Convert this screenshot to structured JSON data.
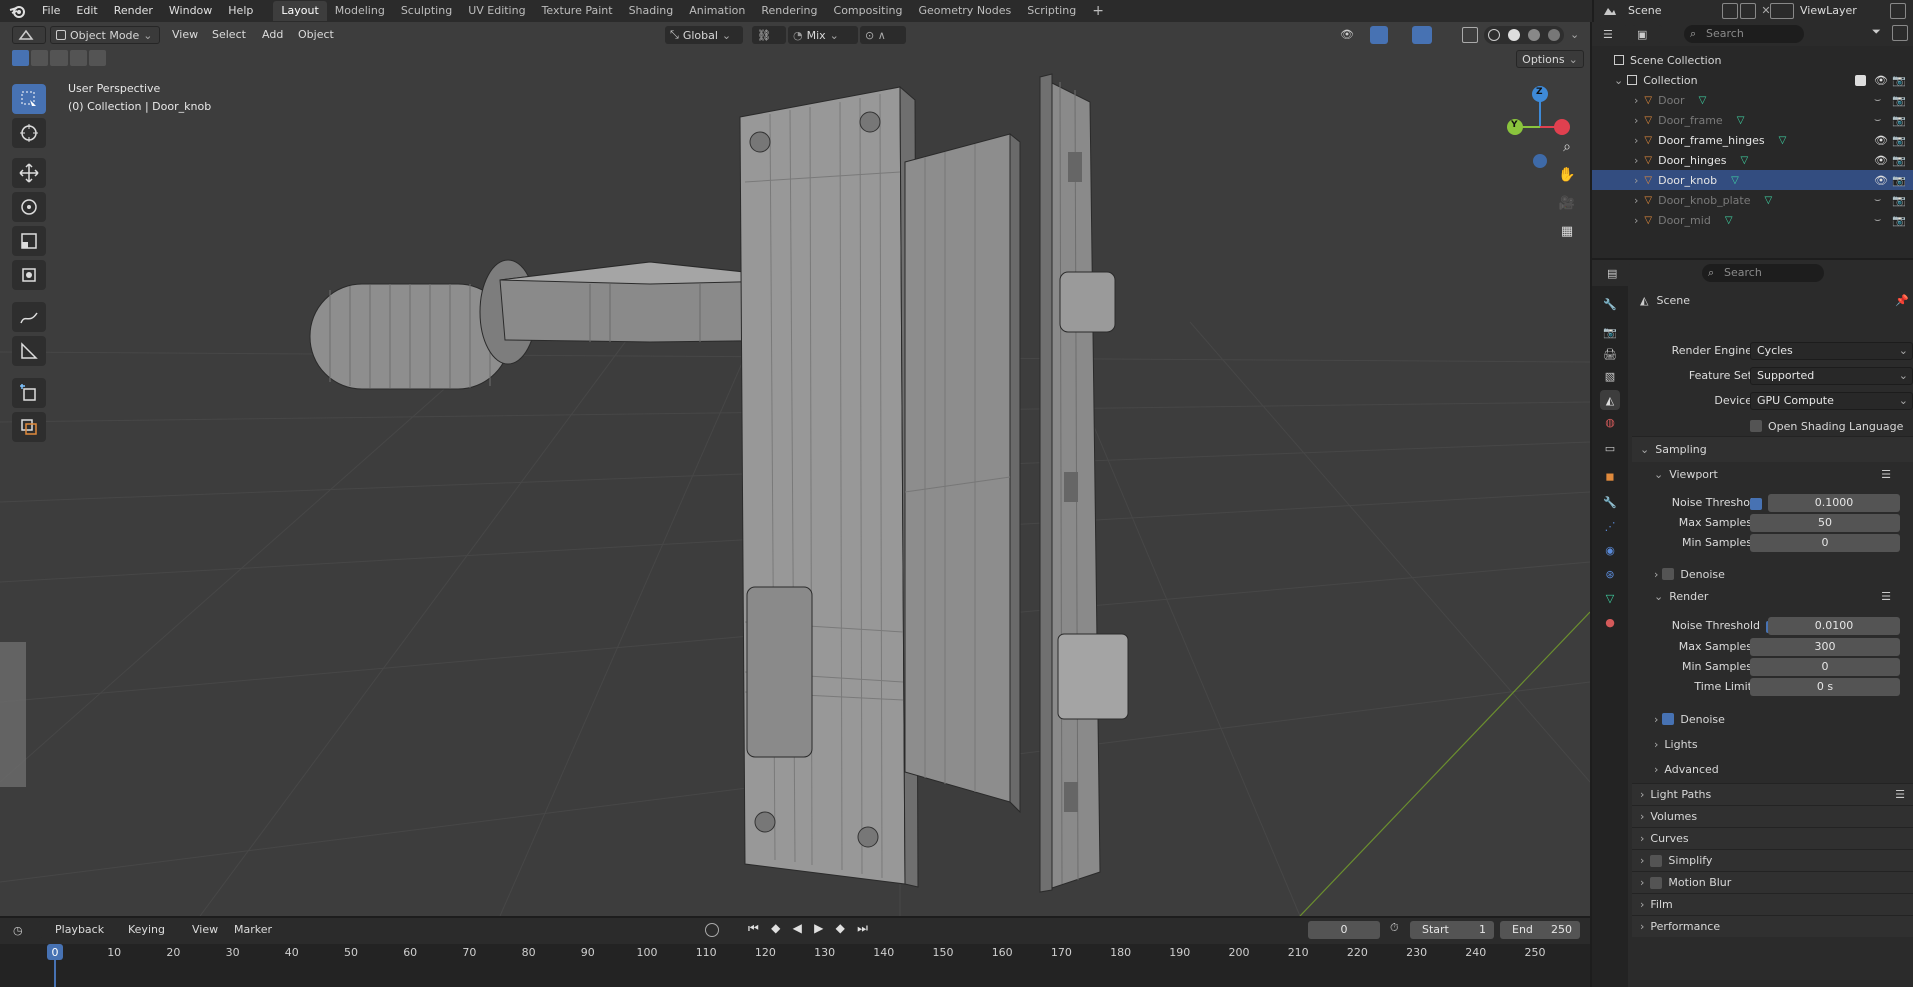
{
  "app": {
    "menus": [
      "File",
      "Edit",
      "Render",
      "Window",
      "Help"
    ],
    "workspaces": [
      "Layout",
      "Modeling",
      "Sculpting",
      "UV Editing",
      "Texture Paint",
      "Shading",
      "Animation",
      "Rendering",
      "Compositing",
      "Geometry Nodes",
      "Scripting"
    ],
    "active_workspace": "Layout",
    "add_tab": "+",
    "scene": "Scene",
    "view_layer": "ViewLayer"
  },
  "viewport": {
    "mode": "Object Mode",
    "menus": [
      "View",
      "Select",
      "Add",
      "Object"
    ],
    "transform_orientation": "Global",
    "snap_mode": "Mix",
    "options": "Options",
    "overlay_title": "User Perspective",
    "overlay_subtitle": "(0) Collection | Door_knob",
    "gizmo": {
      "z": "Z",
      "y": "Y"
    }
  },
  "timeline": {
    "menus": [
      "Playback",
      "Keying",
      "View",
      "Marker"
    ],
    "current_frame": "0",
    "start_label": "Start",
    "start": "1",
    "end_label": "End",
    "end": "250",
    "ticks": [
      "0",
      "10",
      "20",
      "30",
      "40",
      "50",
      "60",
      "70",
      "80",
      "90",
      "100",
      "110",
      "120",
      "130",
      "140",
      "150",
      "160",
      "170",
      "180",
      "190",
      "200",
      "210",
      "220",
      "230",
      "240",
      "250"
    ]
  },
  "outliner": {
    "search_placeholder": "Search",
    "scene_collection": "Scene Collection",
    "collection": "Collection",
    "items": [
      {
        "name": "Door",
        "visible": false
      },
      {
        "name": "Door_frame",
        "visible": false
      },
      {
        "name": "Door_frame_hinges",
        "visible": true
      },
      {
        "name": "Door_hinges",
        "visible": true
      },
      {
        "name": "Door_knob",
        "visible": true
      },
      {
        "name": "Door_knob_plate",
        "visible": false
      },
      {
        "name": "Door_mid",
        "visible": false
      }
    ]
  },
  "properties": {
    "search_placeholder": "Search",
    "context": "Scene",
    "render_engine_label": "Render Engine",
    "render_engine": "Cycles",
    "feature_set_label": "Feature Set",
    "feature_set": "Supported",
    "device_label": "Device",
    "device": "GPU Compute",
    "osl_label": "Open Shading Language",
    "sampling": "Sampling",
    "viewport_label": "Viewport",
    "vp_noise_label": "Noise Threshold",
    "vp_noise": "0.1000",
    "vp_max_label": "Max Samples",
    "vp_max": "50",
    "vp_min_label": "Min Samples",
    "vp_min": "0",
    "denoise_label": "Denoise",
    "render_label": "Render",
    "r_noise_label": "Noise Threshold",
    "r_noise": "0.0100",
    "r_max_label": "Max Samples",
    "r_max": "300",
    "r_min_label": "Min Samples",
    "r_min": "0",
    "time_limit_label": "Time Limit",
    "time_limit": "0 s",
    "r_denoise_label": "Denoise",
    "lights": "Lights",
    "advanced": "Advanced",
    "panels": [
      "Light Paths",
      "Volumes",
      "Curves",
      "Simplify",
      "Motion Blur",
      "Film",
      "Performance"
    ]
  },
  "colors": {
    "accent": "#4772b3",
    "mesh_icon": "#3fd4a4",
    "object_icon": "#e08a3c",
    "x_axis": "#e0404f",
    "y_axis": "#8ac43d",
    "z_axis": "#3e8ad8"
  }
}
